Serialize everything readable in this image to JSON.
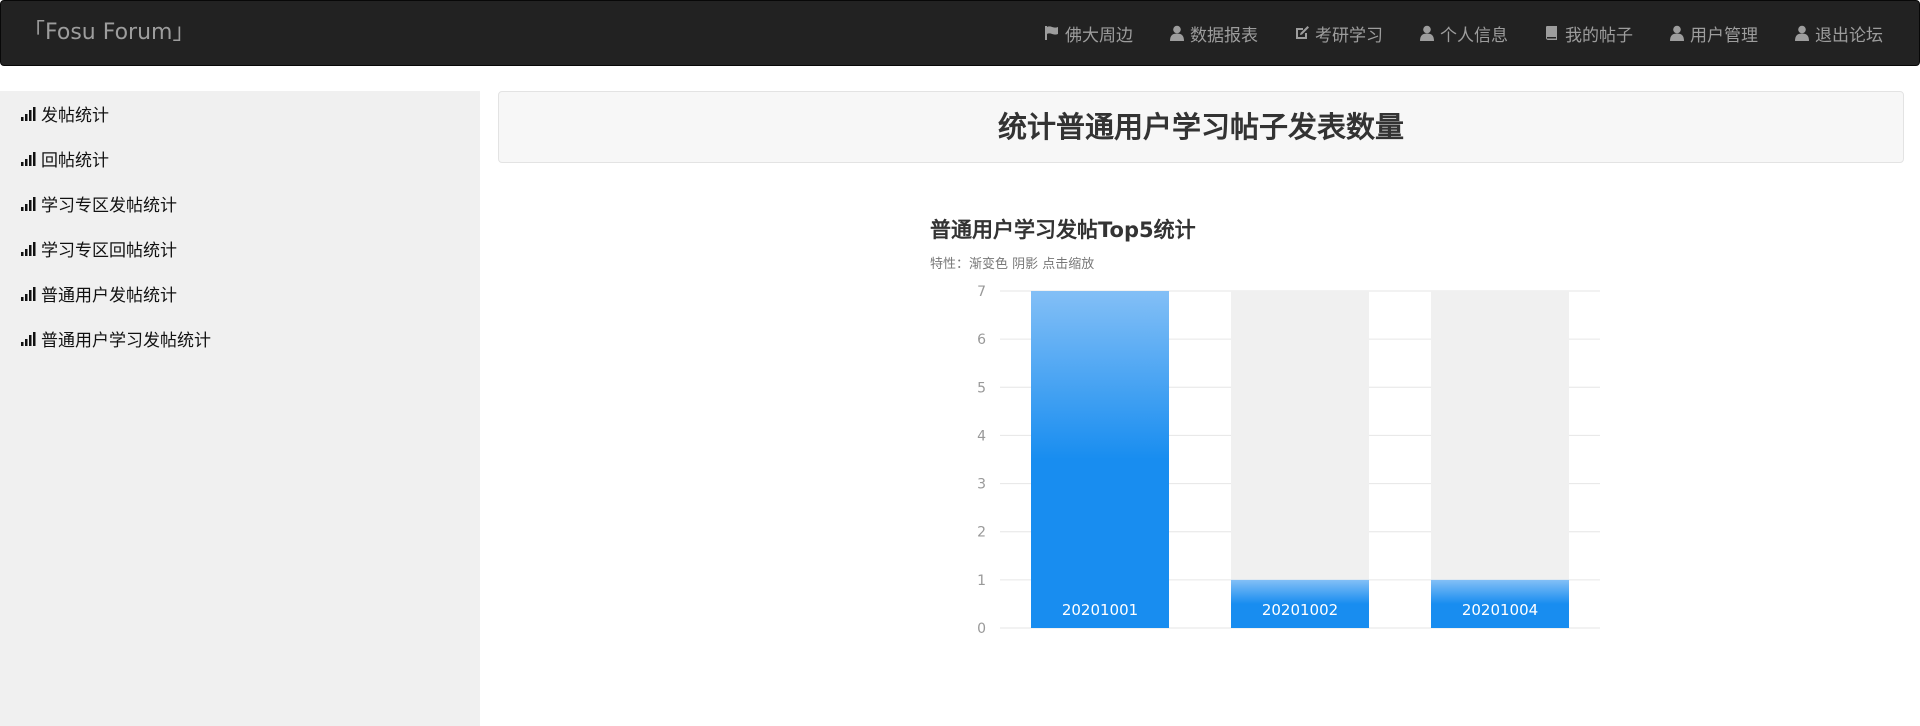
{
  "navbar": {
    "brand": "「Fosu Forum」",
    "items": [
      {
        "label": "佛大周边",
        "icon": "flag-icon"
      },
      {
        "label": "数据报表",
        "icon": "user-icon"
      },
      {
        "label": "考研学习",
        "icon": "edit-icon"
      },
      {
        "label": "个人信息",
        "icon": "user-icon"
      },
      {
        "label": "我的帖子",
        "icon": "book-icon"
      },
      {
        "label": "用户管理",
        "icon": "user-icon"
      },
      {
        "label": "退出论坛",
        "icon": "user-icon"
      }
    ]
  },
  "sidebar": {
    "items": [
      {
        "label": "发帖统计",
        "icon": "signal-icon"
      },
      {
        "label": "回帖统计",
        "icon": "signal-icon"
      },
      {
        "label": "学习专区发帖统计",
        "icon": "signal-icon"
      },
      {
        "label": "学习专区回帖统计",
        "icon": "signal-icon"
      },
      {
        "label": "普通用户发帖统计",
        "icon": "signal-icon"
      },
      {
        "label": "普通用户学习发帖统计",
        "icon": "signal-icon"
      }
    ]
  },
  "main": {
    "title": "统计普通用户学习帖子发表数量"
  },
  "chart_data": {
    "type": "bar",
    "title": "普通用户学习发帖Top5统计",
    "subtitle": "特性：渐变色 阴影 点击缩放",
    "categories": [
      "20201001",
      "20201002",
      "20201004"
    ],
    "values": [
      7,
      1,
      1
    ],
    "ylim": [
      0,
      7
    ],
    "yticks": [
      0,
      1,
      2,
      3,
      4,
      5,
      6,
      7
    ],
    "grid": true,
    "background_bar_color": "#f0f0f0",
    "bar_color": "#188df0",
    "bar_color_top": "#83bff6"
  }
}
